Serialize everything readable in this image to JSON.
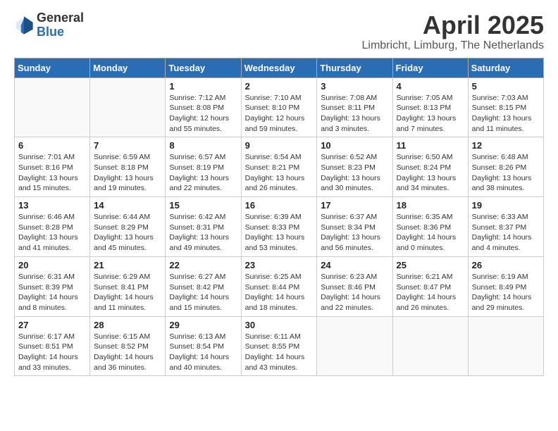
{
  "header": {
    "logo_general": "General",
    "logo_blue": "Blue",
    "title": "April 2025",
    "subtitle": "Limbricht, Limburg, The Netherlands"
  },
  "days_of_week": [
    "Sunday",
    "Monday",
    "Tuesday",
    "Wednesday",
    "Thursday",
    "Friday",
    "Saturday"
  ],
  "weeks": [
    [
      {
        "day": "",
        "info": ""
      },
      {
        "day": "",
        "info": ""
      },
      {
        "day": "1",
        "info": "Sunrise: 7:12 AM\nSunset: 8:08 PM\nDaylight: 12 hours\nand 55 minutes."
      },
      {
        "day": "2",
        "info": "Sunrise: 7:10 AM\nSunset: 8:10 PM\nDaylight: 12 hours\nand 59 minutes."
      },
      {
        "day": "3",
        "info": "Sunrise: 7:08 AM\nSunset: 8:11 PM\nDaylight: 13 hours\nand 3 minutes."
      },
      {
        "day": "4",
        "info": "Sunrise: 7:05 AM\nSunset: 8:13 PM\nDaylight: 13 hours\nand 7 minutes."
      },
      {
        "day": "5",
        "info": "Sunrise: 7:03 AM\nSunset: 8:15 PM\nDaylight: 13 hours\nand 11 minutes."
      }
    ],
    [
      {
        "day": "6",
        "info": "Sunrise: 7:01 AM\nSunset: 8:16 PM\nDaylight: 13 hours\nand 15 minutes."
      },
      {
        "day": "7",
        "info": "Sunrise: 6:59 AM\nSunset: 8:18 PM\nDaylight: 13 hours\nand 19 minutes."
      },
      {
        "day": "8",
        "info": "Sunrise: 6:57 AM\nSunset: 8:19 PM\nDaylight: 13 hours\nand 22 minutes."
      },
      {
        "day": "9",
        "info": "Sunrise: 6:54 AM\nSunset: 8:21 PM\nDaylight: 13 hours\nand 26 minutes."
      },
      {
        "day": "10",
        "info": "Sunrise: 6:52 AM\nSunset: 8:23 PM\nDaylight: 13 hours\nand 30 minutes."
      },
      {
        "day": "11",
        "info": "Sunrise: 6:50 AM\nSunset: 8:24 PM\nDaylight: 13 hours\nand 34 minutes."
      },
      {
        "day": "12",
        "info": "Sunrise: 6:48 AM\nSunset: 8:26 PM\nDaylight: 13 hours\nand 38 minutes."
      }
    ],
    [
      {
        "day": "13",
        "info": "Sunrise: 6:46 AM\nSunset: 8:28 PM\nDaylight: 13 hours\nand 41 minutes."
      },
      {
        "day": "14",
        "info": "Sunrise: 6:44 AM\nSunset: 8:29 PM\nDaylight: 13 hours\nand 45 minutes."
      },
      {
        "day": "15",
        "info": "Sunrise: 6:42 AM\nSunset: 8:31 PM\nDaylight: 13 hours\nand 49 minutes."
      },
      {
        "day": "16",
        "info": "Sunrise: 6:39 AM\nSunset: 8:33 PM\nDaylight: 13 hours\nand 53 minutes."
      },
      {
        "day": "17",
        "info": "Sunrise: 6:37 AM\nSunset: 8:34 PM\nDaylight: 13 hours\nand 56 minutes."
      },
      {
        "day": "18",
        "info": "Sunrise: 6:35 AM\nSunset: 8:36 PM\nDaylight: 14 hours\nand 0 minutes."
      },
      {
        "day": "19",
        "info": "Sunrise: 6:33 AM\nSunset: 8:37 PM\nDaylight: 14 hours\nand 4 minutes."
      }
    ],
    [
      {
        "day": "20",
        "info": "Sunrise: 6:31 AM\nSunset: 8:39 PM\nDaylight: 14 hours\nand 8 minutes."
      },
      {
        "day": "21",
        "info": "Sunrise: 6:29 AM\nSunset: 8:41 PM\nDaylight: 14 hours\nand 11 minutes."
      },
      {
        "day": "22",
        "info": "Sunrise: 6:27 AM\nSunset: 8:42 PM\nDaylight: 14 hours\nand 15 minutes."
      },
      {
        "day": "23",
        "info": "Sunrise: 6:25 AM\nSunset: 8:44 PM\nDaylight: 14 hours\nand 18 minutes."
      },
      {
        "day": "24",
        "info": "Sunrise: 6:23 AM\nSunset: 8:46 PM\nDaylight: 14 hours\nand 22 minutes."
      },
      {
        "day": "25",
        "info": "Sunrise: 6:21 AM\nSunset: 8:47 PM\nDaylight: 14 hours\nand 26 minutes."
      },
      {
        "day": "26",
        "info": "Sunrise: 6:19 AM\nSunset: 8:49 PM\nDaylight: 14 hours\nand 29 minutes."
      }
    ],
    [
      {
        "day": "27",
        "info": "Sunrise: 6:17 AM\nSunset: 8:51 PM\nDaylight: 14 hours\nand 33 minutes."
      },
      {
        "day": "28",
        "info": "Sunrise: 6:15 AM\nSunset: 8:52 PM\nDaylight: 14 hours\nand 36 minutes."
      },
      {
        "day": "29",
        "info": "Sunrise: 6:13 AM\nSunset: 8:54 PM\nDaylight: 14 hours\nand 40 minutes."
      },
      {
        "day": "30",
        "info": "Sunrise: 6:11 AM\nSunset: 8:55 PM\nDaylight: 14 hours\nand 43 minutes."
      },
      {
        "day": "",
        "info": ""
      },
      {
        "day": "",
        "info": ""
      },
      {
        "day": "",
        "info": ""
      }
    ]
  ]
}
